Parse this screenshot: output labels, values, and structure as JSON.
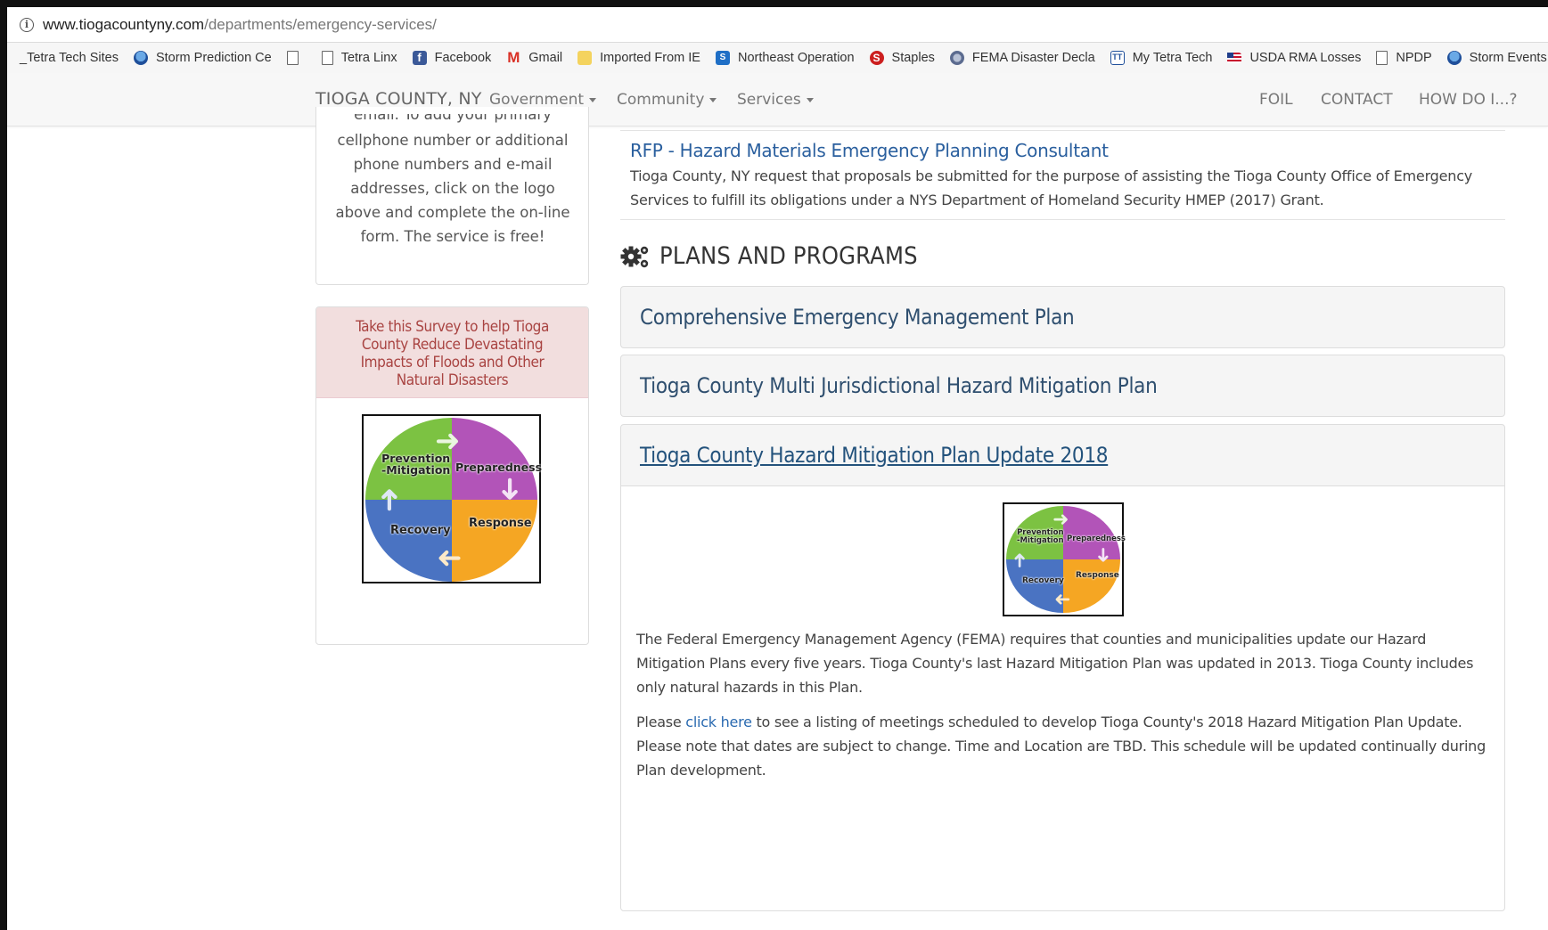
{
  "browser": {
    "url_host": "www.tiogacountyny.com",
    "url_path": "/departments/emergency-services/",
    "bookmarks": [
      {
        "label": "_Tetra Tech Sites",
        "icon": "folder-icon"
      },
      {
        "label": "Storm Prediction Ce",
        "icon": "noaa-icon"
      },
      {
        "label": "",
        "icon": "page-icon"
      },
      {
        "label": "Tetra Linx",
        "icon": "page-icon"
      },
      {
        "label": "Facebook",
        "icon": "facebook-icon"
      },
      {
        "label": "Gmail",
        "icon": "gmail-icon"
      },
      {
        "label": "Imported From IE",
        "icon": "folder-icon"
      },
      {
        "label": "Northeast Operation",
        "icon": "sharepoint-icon"
      },
      {
        "label": "Staples",
        "icon": "staples-icon"
      },
      {
        "label": "FEMA Disaster Decla",
        "icon": "fema-icon"
      },
      {
        "label": "My Tetra Tech",
        "icon": "tetratech-icon"
      },
      {
        "label": "USDA RMA Losses",
        "icon": "flag-icon"
      },
      {
        "label": "NPDP",
        "icon": "page-icon"
      },
      {
        "label": "Storm Events",
        "icon": "noaa-icon"
      }
    ]
  },
  "navbar": {
    "brand": "TIOGA COUNTY, NY",
    "government": "Government",
    "community": "Community",
    "services": "Services",
    "foil": "FOIL",
    "contact": "CONTACT",
    "howdoi": "HOW DO I...?"
  },
  "sidebar": {
    "alert_cutoff_line": "email. To add your primary",
    "alert_text": "cellphone number or additional phone numbers and e-mail addresses, click on the logo above and complete the on-line form. The service is free!",
    "survey_title": "Take this Survey to help Tioga County Reduce Devastating Impacts of Floods and Other Natural Disasters"
  },
  "cycle_logo": {
    "prevention": "Prevention",
    "mitigation": "-Mitigation",
    "preparedness": "Preparedness",
    "recovery": "Recovery",
    "response": "Response"
  },
  "main": {
    "rfp_title": "RFP - Hazard Materials Emergency Planning Consultant",
    "rfp_desc": "Tioga County, NY request that proposals be submitted for the purpose of assisting the Tioga County Office of Emergency Services to fulfill its obligations under a NYS Department of Homeland Security HMEP (2017) Grant.",
    "section_title": "PLANS AND PROGRAMS",
    "plans": [
      "Comprehensive Emergency Management Plan",
      "Tioga County Multi Jurisdictional Hazard Mitigation Plan",
      "Tioga County Hazard Mitigation Plan Update 2018"
    ],
    "para1": "The Federal Emergency Management Agency (FEMA) requires that counties and municipalities update our Hazard Mitigation Plans every five years.  Tioga County's last Hazard Mitigation Plan was updated in 2013.  Tioga County includes only natural hazards in this Plan.",
    "para2_pre": "Please ",
    "para2_link": "click here",
    "para2_post": " to see a listing of meetings scheduled to develop Tioga County's 2018 Hazard Mitigation Plan Update.  Please note that dates are subject to change.  Time and Location are TBD.  This schedule will be updated continually during Plan development."
  },
  "colors": {
    "link": "#2a5f9e",
    "survey_bg": "#f2dede",
    "survey_text": "#a94442",
    "accordion_bg": "#f5f5f5"
  }
}
